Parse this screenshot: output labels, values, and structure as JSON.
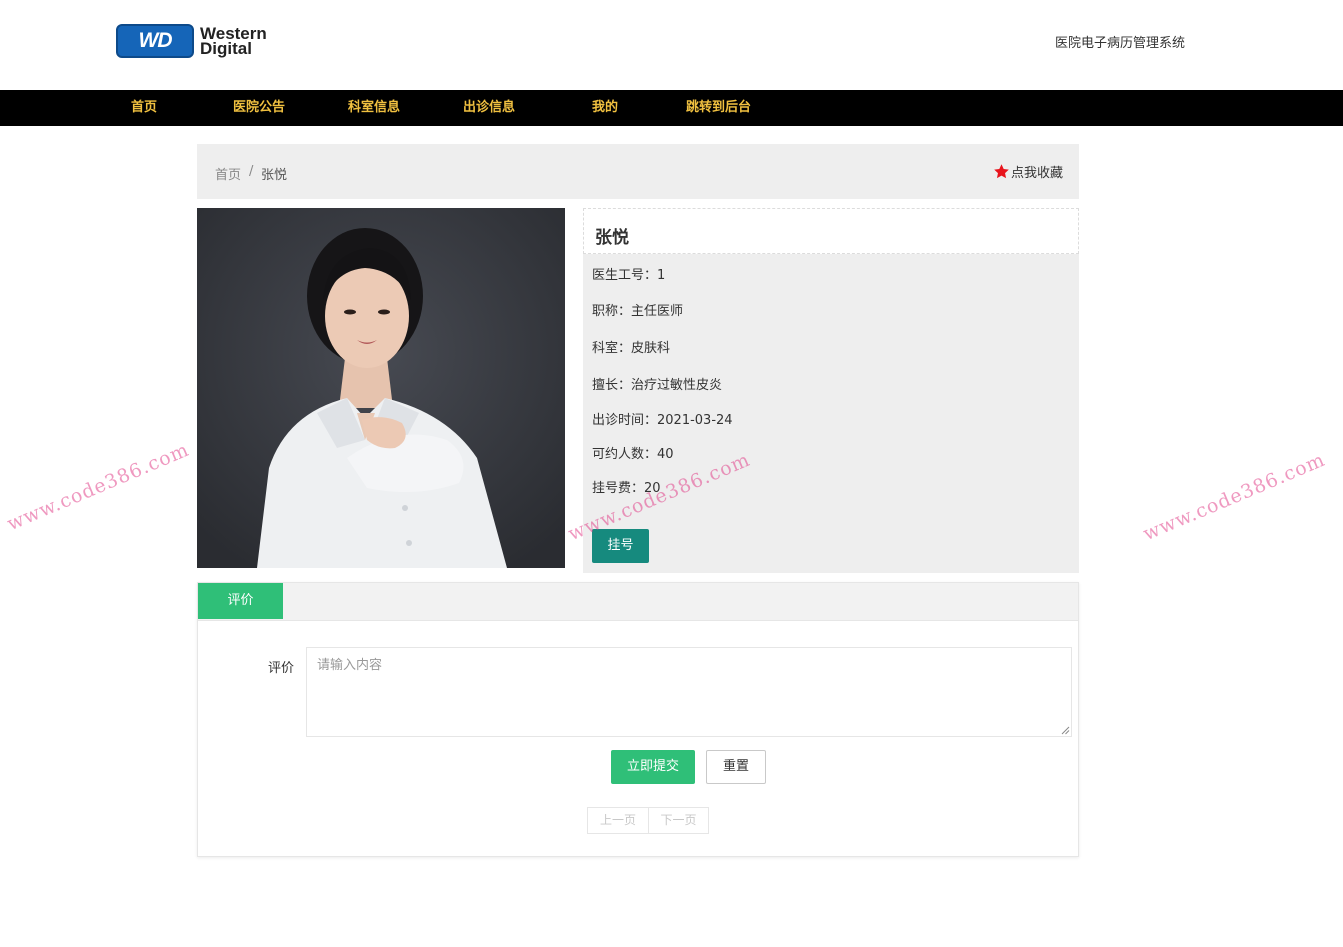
{
  "header": {
    "logo_mark": "WD",
    "logo_line1": "Western",
    "logo_line2": "Digital",
    "system_title": "医院电子病历管理系统"
  },
  "nav": {
    "items": [
      {
        "label": "首页"
      },
      {
        "label": "医院公告"
      },
      {
        "label": "科室信息"
      },
      {
        "label": "出诊信息"
      },
      {
        "label": "我的"
      },
      {
        "label": "跳转到后台"
      }
    ],
    "color": "#f0c040"
  },
  "breadcrumb": {
    "home": "首页",
    "separator": "/",
    "current": "张悦",
    "favorite_label": "点我收藏"
  },
  "doctor": {
    "name": "张悦",
    "rows": [
      {
        "label": "医生工号：",
        "value": "1"
      },
      {
        "label": "职称：",
        "value": "主任医师"
      },
      {
        "label": "科室：",
        "value": "皮肤科"
      },
      {
        "label": "擅长：",
        "value": "治疗过敏性皮炎"
      },
      {
        "label": "出诊时间：",
        "value": "2021-03-24"
      },
      {
        "label": "可约人数：",
        "value": "40"
      },
      {
        "label": "挂号费：",
        "value": "20"
      }
    ],
    "book_button": "挂号"
  },
  "review": {
    "tab_label": "评价",
    "field_label": "评价",
    "placeholder": "请输入内容",
    "submit_label": "立即提交",
    "reset_label": "重置",
    "prev_label": "上一页",
    "next_label": "下一页"
  },
  "watermark": {
    "text": "www.code386.com"
  },
  "colors": {
    "accent_green": "#2fbf78",
    "teal_button": "#168a7e",
    "nav_bg": "#000000",
    "star": "#e8141c"
  }
}
